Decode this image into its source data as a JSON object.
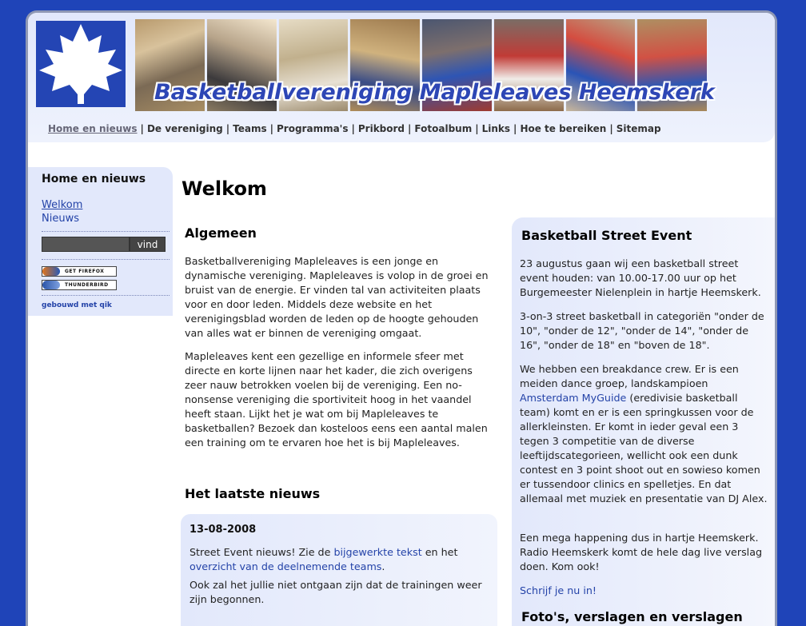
{
  "site": {
    "title": "Basketballvereniging Mapleleaves Heemskerk"
  },
  "nav": [
    {
      "label": "Home en nieuws"
    },
    {
      "label": "De vereniging"
    },
    {
      "label": "Teams"
    },
    {
      "label": "Programma's"
    },
    {
      "label": "Prikbord"
    },
    {
      "label": "Fotoalbum"
    },
    {
      "label": "Links"
    },
    {
      "label": "Hoe te bereiken"
    },
    {
      "label": "Sitemap"
    }
  ],
  "sidebar": {
    "heading": "Home en nieuws",
    "links": [
      "Welkom",
      "Nieuws"
    ],
    "search_button": "vind",
    "badges": [
      "GET FIREFOX",
      "THUNDERBIRD"
    ],
    "built_with": "gebouwd met qik"
  },
  "main": {
    "title": "Welkom",
    "general_heading": "Algemeen",
    "para1": "Basketballvereniging Mapleleaves is een jonge en dynamische vereniging. Mapleleaves is volop in de groei en bruist van de energie. Er vinden tal van activiteiten plaats voor en door leden. Middels deze website en het verenigingsblad worden de leden op de hoogte gehouden van alles wat er binnen de vereniging omgaat.",
    "para2": "Mapleleaves kent een gezellige en informele sfeer met directe en korte lijnen naar het kader, die zich overigens zeer nauw betrokken voelen bij de vereniging. Een no-nonsense vereniging die sportiviteit hoog in het vaandel heeft staan. Lijkt het je wat om bij Mapleleaves te basketballen? Bezoek dan kosteloos eens een aantal malen een training om te ervaren hoe het is bij Mapleleaves.",
    "news_heading": "Het laatste nieuws",
    "news": {
      "date": "13-08-2008",
      "line1_a": "Street Event nieuws! Zie de ",
      "line1_link1": "bijgewerkte tekst",
      "line1_b": " en het ",
      "line1_link2": "overzicht van de deelnemende teams",
      "line1_c": ".",
      "line2": "Ook zal het jullie niet ontgaan zijn dat de trainingen weer zijn begonnen."
    }
  },
  "event": {
    "heading": "Basketball Street Event",
    "p1": "23 augustus gaan wij een basketball street event houden: van 10.00-17.00 uur op het Burgemeester Nielenplein in hartje Heemskerk.",
    "p2": "3-on-3 street basketball in categoriën \"onder de 10\", \"onder de 12\", \"onder de 14\", \"onder de 16\", \"onder de 18\" en \"boven de 18\".",
    "p3_a": "We hebben een breakdance crew. Er is een meiden dance groep, landskampioen ",
    "p3_link": "Amsterdam MyGuide",
    "p3_b": " (eredivisie basketball team) komt en er is een springkussen voor de allerkleinsten. Er komt in ieder geval een 3 tegen 3 competitie van de diverse leeftijdscategorieen, wellicht ook een dunk contest en 3 point shoot out en sowieso komen er tussendoor clinics en spelletjes. En dat allemaal met muziek en presentatie van DJ Alex.",
    "p4": "Een mega happening dus in hartje Heemskerk. Radio Heemskerk komt de hele dag live verslag doen. Kom ook!",
    "signup_link": "Schrijf je nu in!",
    "next_heading": "Foto's, verslagen en verslagen"
  },
  "colors": {
    "page_bg": "#1f44b8",
    "panel_bg": "#e2e8fb",
    "link": "#2443a8"
  }
}
